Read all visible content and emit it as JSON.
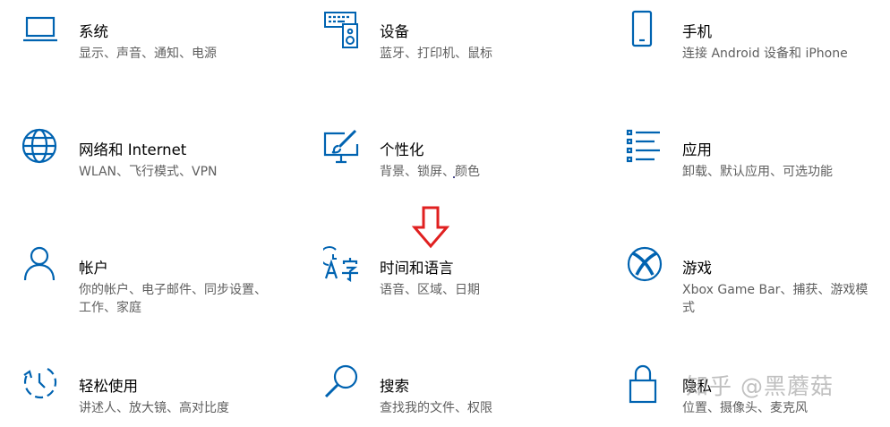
{
  "settings": {
    "tiles": [
      {
        "title": "系统",
        "desc": "显示、声音、通知、电源",
        "icon": "laptop-icon"
      },
      {
        "title": "设备",
        "desc": "蓝牙、打印机、鼠标",
        "icon": "keyboard-speaker-icon"
      },
      {
        "title": "手机",
        "desc": "连接 Android 设备和 iPhone",
        "icon": "phone-icon"
      },
      {
        "title": "网络和 Internet",
        "desc": "WLAN、飞行模式、VPN",
        "icon": "globe-icon"
      },
      {
        "title": "个性化",
        "desc": "背景、锁屏、颜色",
        "icon": "paintbrush-monitor-icon"
      },
      {
        "title": "应用",
        "desc": "卸载、默认应用、可选功能",
        "icon": "app-list-icon"
      },
      {
        "title": "帐户",
        "desc": "你的帐户、电子邮件、同步设置、工作、家庭",
        "icon": "person-icon"
      },
      {
        "title": "时间和语言",
        "desc": "语音、区域、日期",
        "icon": "time-language-icon"
      },
      {
        "title": "游戏",
        "desc": "Xbox Game Bar、捕获、游戏模式",
        "icon": "xbox-icon"
      },
      {
        "title": "轻松使用",
        "desc": "讲述人、放大镜、高对比度",
        "icon": "ease-of-access-icon"
      },
      {
        "title": "搜索",
        "desc": "查找我的文件、权限",
        "icon": "search-icon"
      },
      {
        "title": "隐私",
        "desc": "位置、摄像头、麦克风",
        "icon": "lock-icon"
      }
    ]
  },
  "annotation": {
    "arrow": "down-arrow-icon",
    "color": "#e02020"
  },
  "watermark": {
    "text": "知乎 @黑蘑菇"
  },
  "colors": {
    "accent": "#0063b1",
    "title": "#000000",
    "desc": "#5f5f5f"
  }
}
